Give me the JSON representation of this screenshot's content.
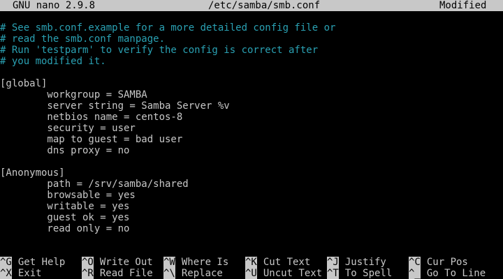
{
  "titlebar": {
    "app": "GNU nano 2.9.8",
    "file": "/etc/samba/smb.conf",
    "status": "Modified"
  },
  "editor": {
    "lines": [
      {
        "text": "# See smb.conf.example for a more detailed config file or",
        "kind": "comment"
      },
      {
        "text": "# read the smb.conf manpage.",
        "kind": "comment"
      },
      {
        "text": "# Run 'testparm' to verify the config is correct after",
        "kind": "comment"
      },
      {
        "text": "# you modified it.",
        "kind": "comment"
      },
      {
        "text": "",
        "kind": "code"
      },
      {
        "text": "[global]",
        "kind": "code"
      },
      {
        "text": "        workgroup = SAMBA",
        "kind": "code"
      },
      {
        "text": "        server string = Samba Server %v",
        "kind": "code"
      },
      {
        "text": "        netbios name = centos-8",
        "kind": "code"
      },
      {
        "text": "        security = user",
        "kind": "code"
      },
      {
        "text": "        map to guest = bad user",
        "kind": "code"
      },
      {
        "text": "        dns proxy = no",
        "kind": "code"
      },
      {
        "text": "",
        "kind": "code"
      },
      {
        "text": "[Anonymous]",
        "kind": "code"
      },
      {
        "text": "        path = /srv/samba/shared",
        "kind": "code"
      },
      {
        "text": "        browsable = yes",
        "kind": "code"
      },
      {
        "text": "        writable = yes",
        "kind": "code"
      },
      {
        "text": "        guest ok = yes",
        "kind": "code"
      },
      {
        "text": "        read only = no",
        "kind": "code"
      }
    ]
  },
  "shortcuts": {
    "row1": [
      {
        "key": "^G",
        "label": "Get Help"
      },
      {
        "key": "^O",
        "label": "Write Out"
      },
      {
        "key": "^W",
        "label": "Where Is"
      },
      {
        "key": "^K",
        "label": "Cut Text"
      },
      {
        "key": "^J",
        "label": "Justify"
      },
      {
        "key": "^C",
        "label": "Cur Pos"
      }
    ],
    "row2": [
      {
        "key": "^X",
        "label": "Exit"
      },
      {
        "key": "^R",
        "label": "Read File"
      },
      {
        "key": "^\\",
        "label": "Replace"
      },
      {
        "key": "^U",
        "label": "Uncut Text"
      },
      {
        "key": "^T",
        "label": "To Spell"
      },
      {
        "key": "^_",
        "label": "Go To Line"
      }
    ]
  },
  "colors": {
    "background": "#000000",
    "text": "#c8c8c8",
    "comment": "#2aa1b3",
    "titlebar_bg": "#c8c8c8"
  }
}
